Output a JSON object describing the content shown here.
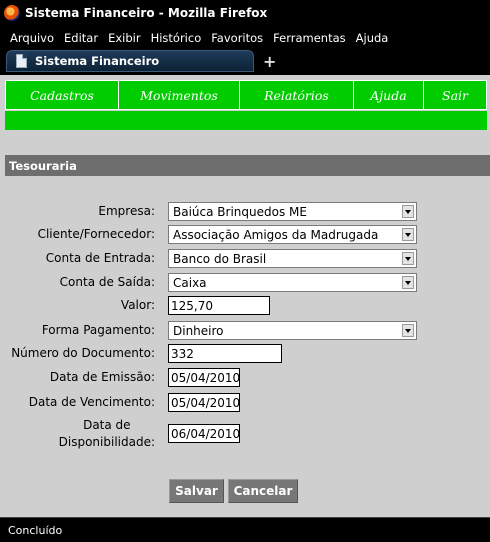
{
  "window": {
    "title": "Sistema Financeiro - Mozilla Firefox"
  },
  "menubar": {
    "items": [
      "Arquivo",
      "Editar",
      "Exibir",
      "Histórico",
      "Favoritos",
      "Ferramentas",
      "Ajuda"
    ]
  },
  "tabs": {
    "active_label": "Sistema Financeiro",
    "new_tab_symbol": "+"
  },
  "nav": {
    "items": [
      "Cadastros",
      "Movimentos",
      "Relatórios",
      "Ajuda",
      "Sair"
    ]
  },
  "section": {
    "title": "Tesouraria"
  },
  "form": {
    "empresa": {
      "label": "Empresa:",
      "value": "Baiúca Brinquedos ME"
    },
    "cliente": {
      "label": "Cliente/Fornecedor:",
      "value": "Associação Amigos da Madrugada"
    },
    "conta_entrada": {
      "label": "Conta de Entrada:",
      "value": "Banco do Brasil"
    },
    "conta_saida": {
      "label": "Conta de Saída:",
      "value": "Caixa"
    },
    "valor": {
      "label": "Valor:",
      "value": "125,70"
    },
    "forma_pagamento": {
      "label": "Forma Pagamento:",
      "value": "Dinheiro"
    },
    "numero_documento": {
      "label": "Número do Documento:",
      "value": "332"
    },
    "data_emissao": {
      "label": "Data de Emissão:",
      "value": "05/04/2010"
    },
    "data_vencimento": {
      "label": "Data de Vencimento:",
      "value": "05/04/2010"
    },
    "data_disponibilidade": {
      "label_line1": "Data de",
      "label_line2": "Disponibilidade:",
      "value": "06/04/2010"
    }
  },
  "buttons": {
    "save": "Salvar",
    "cancel": "Cancelar"
  },
  "status": {
    "text": "Concluído"
  },
  "colors": {
    "nav_green": "#00cc00",
    "section_header": "#6e6e6e",
    "content_bg": "#cfcfcf",
    "button_bg": "#777777"
  }
}
